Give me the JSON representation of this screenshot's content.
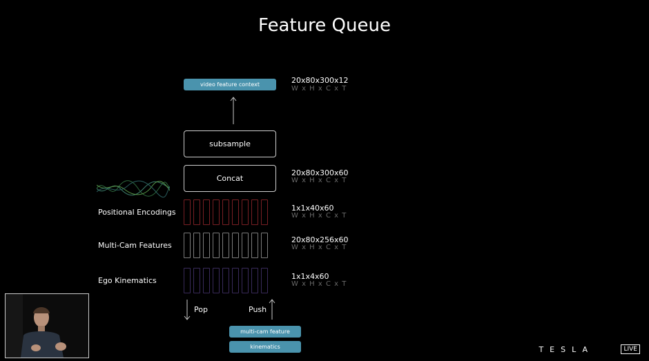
{
  "title": "Feature Queue",
  "output_pill": "video feature context",
  "output_dims": {
    "value": "20x80x300x12",
    "axes": "W x H x C x T"
  },
  "subsample_label": "subsample",
  "concat_label": "Concat",
  "concat_dims": {
    "value": "20x80x300x60",
    "axes": "W x H x C x T"
  },
  "rows": [
    {
      "label": "Positional Encodings",
      "value": "1x1x40x60",
      "axes": "W x H x C x T",
      "color": "#7a2024"
    },
    {
      "label": "Multi-Cam Features",
      "value": "20x80x256x60",
      "axes": "W x H x C x T",
      "color": "#7d7d7d"
    },
    {
      "label": "Ego Kinematics",
      "value": "1x1x4x60",
      "axes": "W x H x C x T",
      "color": "#3a2b5c"
    }
  ],
  "pop_label": "Pop",
  "push_label": "Push",
  "input_pills": [
    "multi-cam feature",
    "kinematics"
  ],
  "brand": "TESLA",
  "live_badge": "LIVE",
  "accent_color": "#4a93ad"
}
